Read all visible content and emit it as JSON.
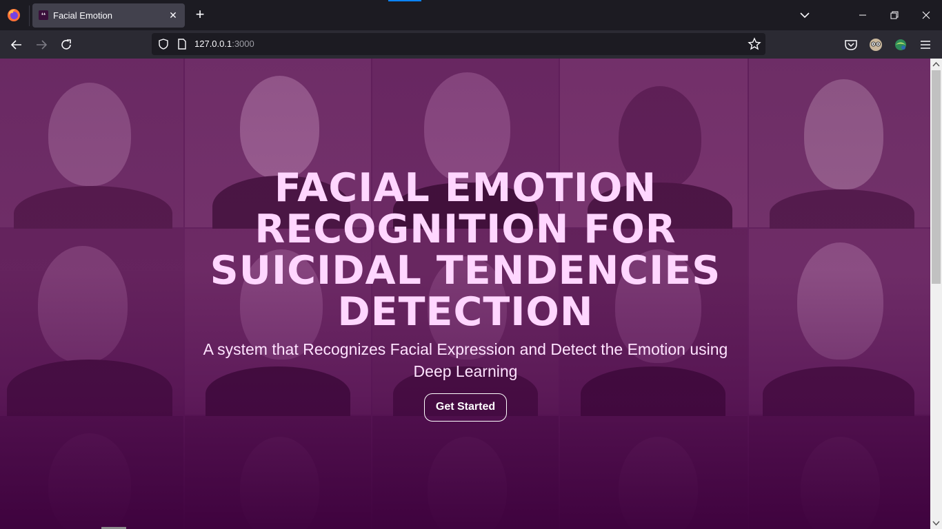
{
  "browser": {
    "tab": {
      "title": "Facial Emotion",
      "favicon_text": "❛❛",
      "close_glyph": "✕"
    },
    "new_tab_glyph": "+",
    "url": {
      "host": "127.0.0.1",
      "port": ":3000"
    },
    "accent_color": "#0a84ff"
  },
  "icons": {
    "back": "arrow-left-icon",
    "forward": "arrow-right-icon",
    "reload": "reload-icon",
    "shield": "shield-icon",
    "page": "page-icon",
    "bookmark": "star-icon",
    "pocket": "pocket-icon",
    "account": "avatar-icon",
    "extension": "extension-icon",
    "menu": "hamburger-menu-icon"
  },
  "hero": {
    "title_lines": [
      "FACIAL EMOTION",
      "RECOGNITION FOR",
      "SUICIDAL TENDENCIES",
      "DETECTION"
    ],
    "subtitle_line1": "A system that Recognizes Facial Expression and Detect the Emotion using",
    "subtitle_line2": "Deep Learning",
    "cta_label": "Get Started",
    "title_color": "#ffd6ff",
    "overlay_color": "#6e2a68"
  }
}
